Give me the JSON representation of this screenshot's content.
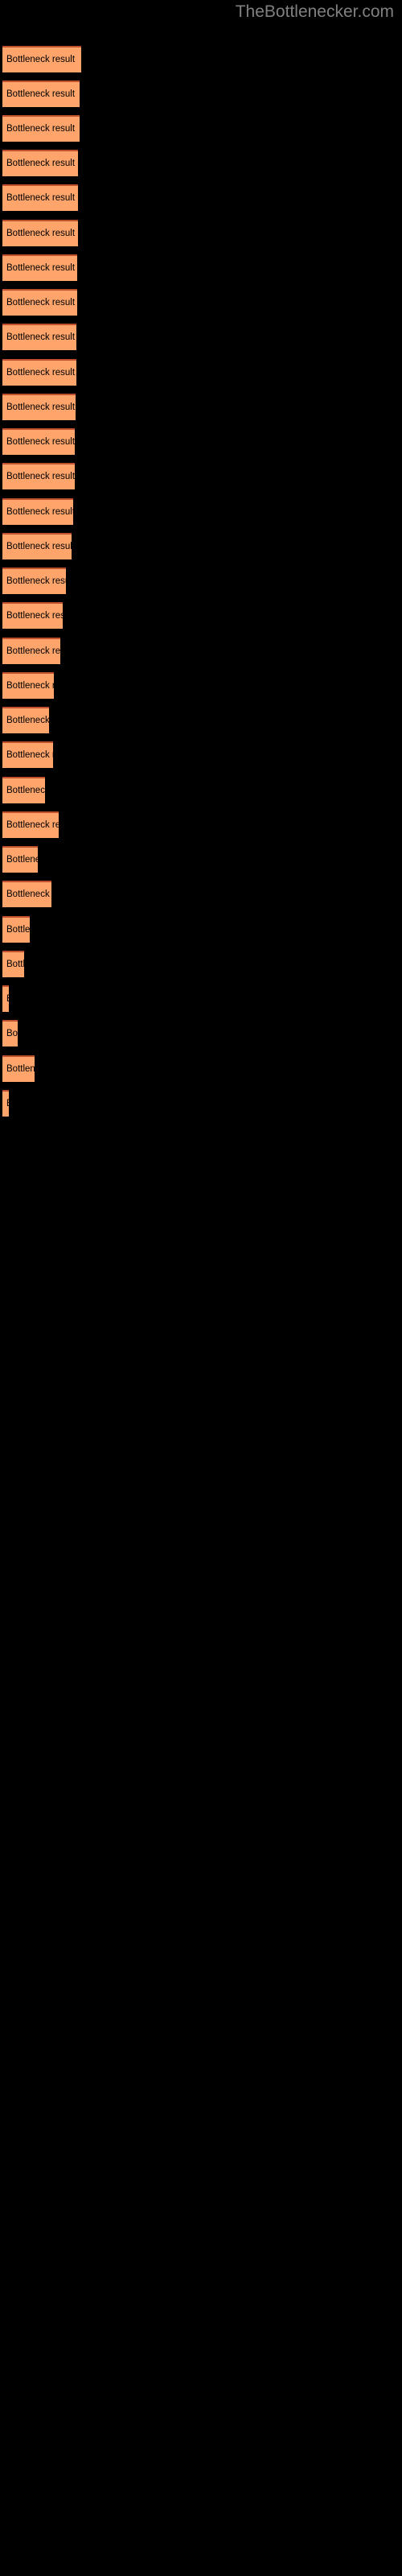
{
  "site": {
    "title": "TheBottlenecker.com"
  },
  "colors": {
    "background": "#000000",
    "bar_fill": "#ffa56b",
    "bar_border_top": "#c1502e",
    "label_text": "#000000",
    "title_text": "#808080"
  },
  "chart_data": {
    "type": "bar",
    "orientation": "horizontal",
    "title": "TheBottlenecker.com",
    "xlabel": "",
    "ylabel": "",
    "grid": false,
    "legend": false,
    "axis_visible": false,
    "bar_label_text": "Bottleneck result",
    "categories": [
      "Bottleneck result",
      "Bottleneck result",
      "Bottleneck result",
      "Bottleneck result",
      "Bottleneck result",
      "Bottleneck result",
      "Bottleneck result",
      "Bottleneck result",
      "Bottleneck result",
      "Bottleneck result",
      "Bottleneck result",
      "Bottleneck result",
      "Bottleneck result",
      "Bottleneck result",
      "Bottleneck result",
      "Bottleneck result",
      "Bottleneck result",
      "Bottleneck result",
      "Bottleneck result",
      "Bottleneck result",
      "Bottleneck result",
      "Bottleneck result",
      "Bottleneck result",
      "Bottleneck result",
      "Bottleneck result",
      "Bottleneck result",
      "Bottleneck result",
      "Bottleneck result",
      "Bottleneck result",
      "Bottleneck result"
    ],
    "values": [
      98,
      96,
      96,
      94,
      94,
      94,
      93,
      93,
      92,
      92,
      91,
      90,
      90,
      88,
      86,
      79,
      75,
      72,
      64,
      58,
      63,
      53,
      70,
      44,
      61,
      34,
      27,
      8,
      19,
      40,
      8
    ],
    "xlim": [
      0,
      100
    ],
    "value_unit": "px-width-relative"
  },
  "bars": [
    {
      "width": 98,
      "top": 57,
      "label": "Bottleneck result"
    },
    {
      "width": 96,
      "top": 100,
      "label": "Bottleneck result"
    },
    {
      "width": 96,
      "top": 143,
      "label": "Bottleneck result"
    },
    {
      "width": 94,
      "top": 186,
      "label": "Bottleneck result"
    },
    {
      "width": 94,
      "top": 229,
      "label": "Bottleneck result"
    },
    {
      "width": 94,
      "top": 273,
      "label": "Bottleneck result"
    },
    {
      "width": 93,
      "top": 316,
      "label": "Bottleneck result"
    },
    {
      "width": 93,
      "top": 359,
      "label": "Bottleneck result"
    },
    {
      "width": 92,
      "top": 402,
      "label": "Bottleneck result"
    },
    {
      "width": 92,
      "top": 446,
      "label": "Bottleneck result"
    },
    {
      "width": 91,
      "top": 489,
      "label": "Bottleneck result"
    },
    {
      "width": 90,
      "top": 532,
      "label": "Bottleneck result"
    },
    {
      "width": 90,
      "top": 575,
      "label": "Bottleneck result"
    },
    {
      "width": 88,
      "top": 619,
      "label": "Bottleneck result"
    },
    {
      "width": 86,
      "top": 662,
      "label": "Bottleneck result"
    },
    {
      "width": 79,
      "top": 705,
      "label": "Bottleneck result"
    },
    {
      "width": 75,
      "top": 748,
      "label": "Bottleneck result"
    },
    {
      "width": 72,
      "top": 792,
      "label": "Bottleneck result"
    },
    {
      "width": 64,
      "top": 835,
      "label": "Bottleneck result"
    },
    {
      "width": 58,
      "top": 878,
      "label": "Bottleneck result"
    },
    {
      "width": 63,
      "top": 921,
      "label": "Bottleneck result"
    },
    {
      "width": 53,
      "top": 965,
      "label": "Bottleneck result"
    },
    {
      "width": 70,
      "top": 1008,
      "label": "Bottleneck result"
    },
    {
      "width": 44,
      "top": 1051,
      "label": "Bottleneck result"
    },
    {
      "width": 61,
      "top": 1094,
      "label": "Bottleneck result"
    },
    {
      "width": 34,
      "top": 1138,
      "label": "Bottleneck result"
    },
    {
      "width": 27,
      "top": 1181,
      "label": "Bottleneck result"
    },
    {
      "width": 8,
      "top": 1224,
      "label": "Bottleneck result"
    },
    {
      "width": 19,
      "top": 1267,
      "label": "Bottleneck result"
    },
    {
      "width": 40,
      "top": 1311,
      "label": "Bottleneck result"
    },
    {
      "width": 8,
      "top": 1354,
      "label": "Bottleneck result"
    }
  ]
}
